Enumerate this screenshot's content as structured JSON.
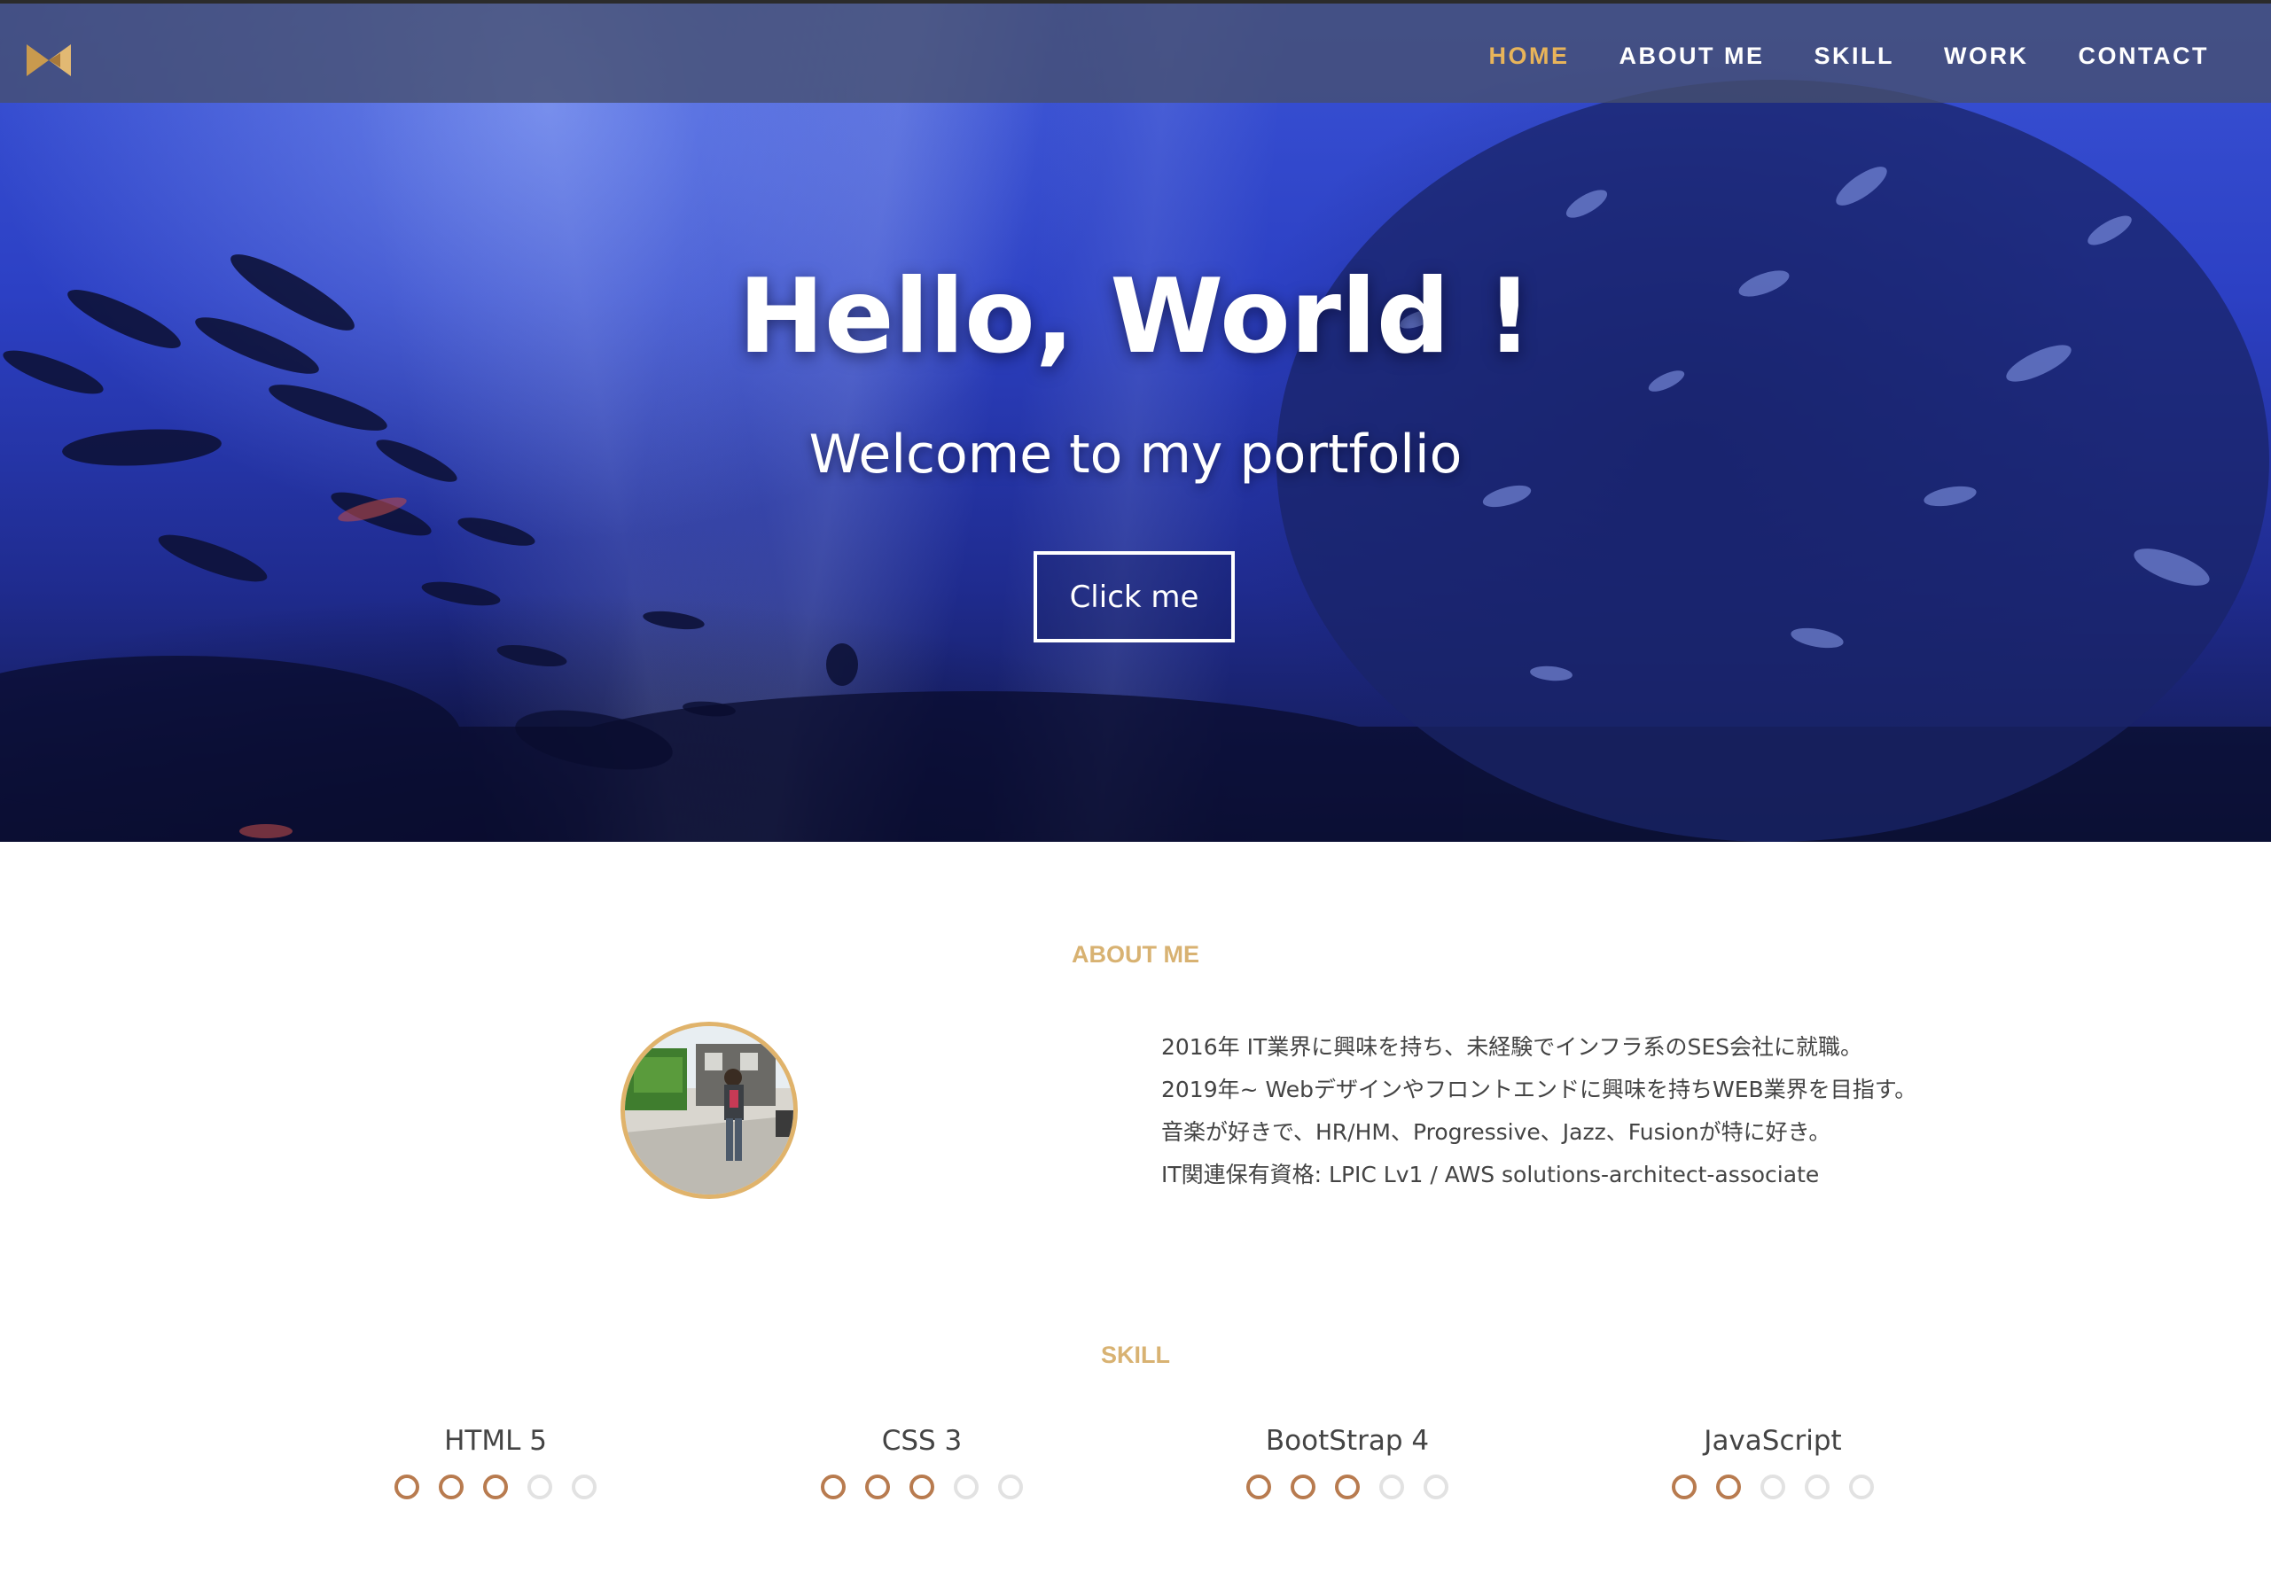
{
  "nav": {
    "items": [
      {
        "label": "HOME",
        "active": true
      },
      {
        "label": "ABOUT ME",
        "active": false
      },
      {
        "label": "SKILL",
        "active": false
      },
      {
        "label": "WORK",
        "active": false
      },
      {
        "label": "CONTACT",
        "active": false
      }
    ],
    "logo_icon": "bowtie-logo-icon"
  },
  "hero": {
    "title": "Hello, World !",
    "subtitle": "Welcome to my portfolio",
    "button_label": "Click me",
    "background": "underwater-fish-photo"
  },
  "about": {
    "heading": "ABOUT ME",
    "avatar": "profile-photo",
    "lines": [
      "2016年 IT業界に興味を持ち、未経験でインフラ系のSES会社に就職。",
      "2019年~ Webデザインやフロントエンドに興味を持ちWEB業界を目指す。",
      "音楽が好きで、HR/HM、Progressive、Jazz、Fusionが特に好き。",
      "IT関連保有資格: LPIC Lv1 / AWS solutions-architect-associate"
    ]
  },
  "skill": {
    "heading": "SKILL",
    "max_level": 5,
    "items": [
      {
        "name": "HTML 5",
        "level": 3
      },
      {
        "name": "CSS 3",
        "level": 3
      },
      {
        "name": "BootStrap 4",
        "level": 3
      },
      {
        "name": "JavaScript",
        "level": 2
      }
    ]
  },
  "colors": {
    "accent": "#e8b45a",
    "heading": "#d8b272",
    "dot_on": "#b87b4f",
    "dot_off": "#e2e2e2",
    "nav_bg": "#46506e"
  }
}
